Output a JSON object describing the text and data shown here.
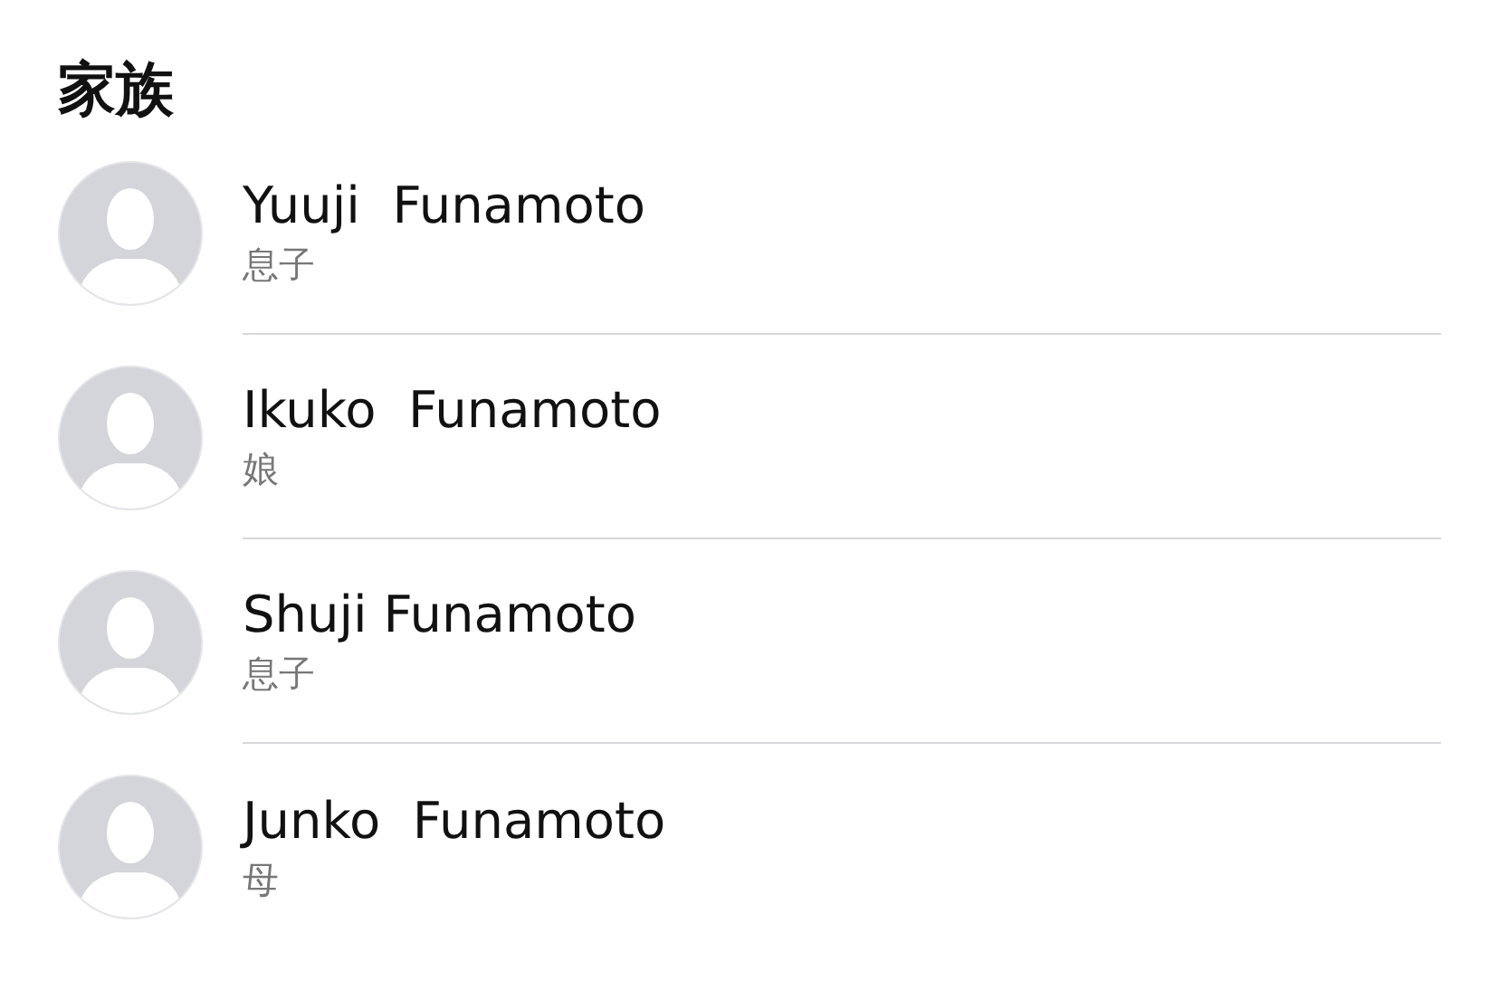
{
  "section": {
    "title": "家族"
  },
  "contacts": [
    {
      "name": "Yuuji  Funamoto",
      "relation": "息子"
    },
    {
      "name": "Ikuko  Funamoto",
      "relation": "娘"
    },
    {
      "name": "Shuji Funamoto",
      "relation": "息子"
    },
    {
      "name": "Junko  Funamoto",
      "relation": "母"
    }
  ]
}
